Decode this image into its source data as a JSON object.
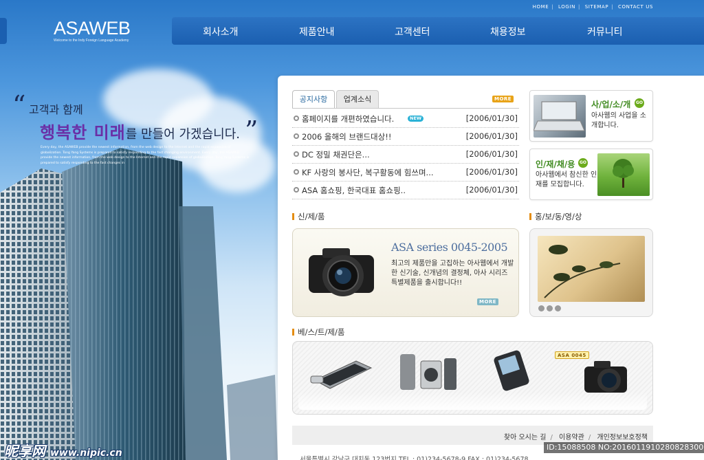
{
  "top_links": [
    "HOME",
    "LOGIN",
    "SITEMAP",
    "CONTACT US"
  ],
  "logo": {
    "title": "ASAWEB",
    "tagline": "Welcome to the Indy Foreign Language Academy"
  },
  "gnb": [
    "회사소개",
    "제품안내",
    "고객센터",
    "채용정보",
    "커뮤니티"
  ],
  "slogan": {
    "line1": "고객과 함께",
    "emphasis": "행복한 미래",
    "rest": "를 만들어 가겠습니다."
  },
  "hero_desc": "Every day, the ASAWEB provide the newest information, from the web design to the Internet and the rapid expansion of globalization. Tong Yang Systems is prepared to satisfy responding to the fast changing environment. Every day, the ASAWEB provide the newest information, from the web design to the Internet and the rapid expansion of globalization. Tong Yang Systems is prepared to satisfy responding to the fast changes in",
  "notice": {
    "tabs": [
      "공지사항",
      "업계소식"
    ],
    "more": "MORE",
    "new_badge": "NEW",
    "items": [
      {
        "title": "홈페이지를 개편하였습니다.",
        "date": "[2006/01/30]"
      },
      {
        "title": "2006 올해의 브랜드대상!!",
        "date": "[2006/01/30]"
      },
      {
        "title": "DC 정밀 채권단은...",
        "date": "[2006/01/30]"
      },
      {
        "title": "KF 사랑의 봉사단, 복구활동에 힘쓰며...",
        "date": "[2006/01/30]"
      },
      {
        "title": "ASA 홈쇼핑, 한국대표 홈쇼핑..",
        "date": "[2006/01/30]"
      }
    ]
  },
  "cards": [
    {
      "title_main": "사/업/소/개",
      "go": "GO",
      "desc": "아사웹의 사업을 소개합니다."
    },
    {
      "title_main": "인/재/채/용",
      "go": "GO",
      "desc": "아사웹에서 참신한 인재를 모집합니다."
    }
  ],
  "new_product": {
    "heading": "신/제/품",
    "title": "ASA series 0045-2005",
    "desc": "최고의 제품만을 고집하는 아사웹에서 개발한 신기술, 신개념의 결정체, 아사 시리즈 특별제품을 출시합니다!!",
    "more": "MORE"
  },
  "promo_video": {
    "heading": "홍/보/동/영/상"
  },
  "best": {
    "heading": "베/스/트/제/품",
    "tag": "ASA 0045"
  },
  "footer": {
    "links": [
      "찾아 오시는 길",
      "이용약관",
      "개인정보보호정책"
    ],
    "address": "서울특별시 강남구 대치동 123번지   TEL : 01)234-5678-9    FAX : 01)234-5678"
  },
  "watermark": {
    "left": "昵享网",
    "url": "www.nipic.cn",
    "id": "ID:15088508 NO:20160119102808283000"
  },
  "colors": {
    "nav": "#1b5fb0",
    "accent_green": "#3f8a1f",
    "accent_orange": "#e48d12",
    "purple": "#6a2fa6"
  }
}
